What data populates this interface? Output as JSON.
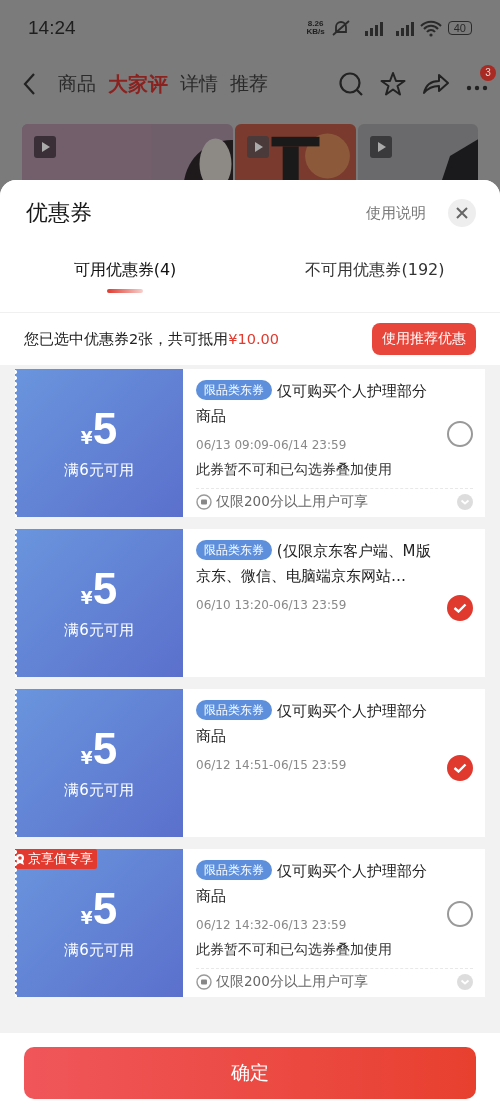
{
  "status_bar": {
    "time": "14:24",
    "speed_value": "8.26",
    "speed_unit": "KB/s",
    "battery": "40"
  },
  "nav": {
    "tabs": [
      {
        "label": "商品",
        "selected": false
      },
      {
        "label": "大家评",
        "selected": true
      },
      {
        "label": "详情",
        "selected": false
      },
      {
        "label": "推荐",
        "selected": false
      }
    ],
    "more_badge": "3"
  },
  "sheet": {
    "title": "优惠券",
    "help_link": "使用说明",
    "tabs": [
      {
        "label": "可用优惠券(4)",
        "selected": true
      },
      {
        "label": "不可用优惠券(192)",
        "selected": false
      }
    ],
    "summary": {
      "text": "您已选中优惠券2张，共可抵用",
      "amount": "¥10.00"
    },
    "recommend_button": "使用推荐优惠",
    "coupons": [
      {
        "currency": "¥",
        "amount": "5",
        "condition": "满6元可用",
        "tag": "限品类东券",
        "title": "仅可购买个人护理部分商品",
        "date": "06/13 09:09-06/14 23:59",
        "note": "此券暂不可和已勾选券叠加使用",
        "restriction": "仅限200分以上用户可享",
        "selected": false
      },
      {
        "currency": "¥",
        "amount": "5",
        "condition": "满6元可用",
        "tag": "限品类东券",
        "title": "(仅限京东客户端、M版京东、微信、电脑端京东网站…",
        "date": "06/10 13:20-06/13 23:59",
        "selected": true
      },
      {
        "currency": "¥",
        "amount": "5",
        "condition": "满6元可用",
        "tag": "限品类东券",
        "title": "仅可购买个人护理部分商品",
        "date": "06/12 14:51-06/15 23:59",
        "selected": true
      },
      {
        "currency": "¥",
        "amount": "5",
        "condition": "满6元可用",
        "badge": "京享值专享",
        "tag": "限品类东券",
        "title": "仅可购买个人护理部分商品",
        "date": "06/12 14:32-06/13 23:59",
        "note": "此券暂不可和已勾选券叠加使用",
        "restriction": "仅限200分以上用户可享",
        "selected": false
      }
    ],
    "confirm_button": "确定"
  }
}
